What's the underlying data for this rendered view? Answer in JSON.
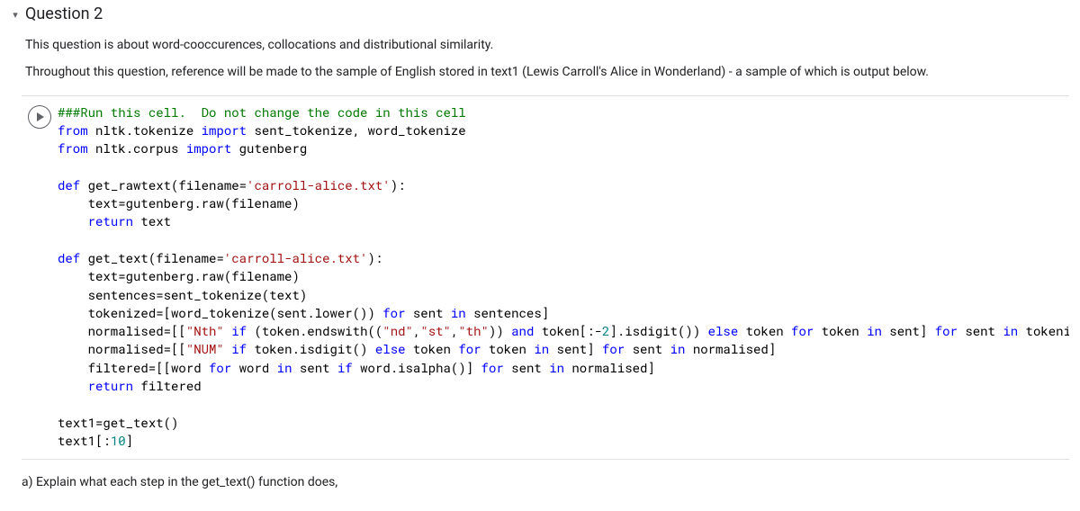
{
  "header": {
    "toggle_glyph": "▾",
    "title": "Question 2"
  },
  "intro": {
    "p1": "This question is about word-cooccurences, collocations and distributional similarity.",
    "p2": "Throughout this question, reference will be made to the sample of English stored in text1 (Lewis Carroll's Alice in Wonderland) - a sample of which is output below."
  },
  "code": {
    "l1_a": "###Run this cell.",
    "l1_b": "  Do not change the code in this cell",
    "l2_a": "from",
    "l2_b": " nltk.tokenize ",
    "l2_c": "import",
    "l2_d": " sent_tokenize, word_tokenize",
    "l3_a": "from",
    "l3_b": " nltk.corpus ",
    "l3_c": "import",
    "l3_d": " gutenberg",
    "l5_a": "def",
    "l5_b": " get_rawtext(filename=",
    "l5_c": "'carroll-alice.txt'",
    "l5_d": "):",
    "l6": "    text=gutenberg.raw(filename)",
    "l7_a": "    ",
    "l7_b": "return",
    "l7_c": " text",
    "l9_a": "def",
    "l9_b": " get_text(filename=",
    "l9_c": "'carroll-alice.txt'",
    "l9_d": "):",
    "l10": "    text=gutenberg.raw(filename)",
    "l11": "    sentences=sent_tokenize(text)",
    "l12_a": "    tokenized=[word_tokenize(sent.lower()) ",
    "l12_b": "for",
    "l12_c": " sent ",
    "l12_d": "in",
    "l12_e": " sentences]",
    "l13_a": "    normalised=[[",
    "l13_b": "\"Nth\"",
    "l13_c": " ",
    "l13_d": "if",
    "l13_e": " (token.endswith((",
    "l13_f": "\"nd\"",
    "l13_g": ",",
    "l13_h": "\"st\"",
    "l13_i": ",",
    "l13_j": "\"th\"",
    "l13_k": ")) ",
    "l13_l": "and",
    "l13_m": " token[:-",
    "l13_n": "2",
    "l13_o": "].isdigit()) ",
    "l13_p": "else",
    "l13_q": " token ",
    "l13_r": "for",
    "l13_s": " token ",
    "l13_t": "in",
    "l13_u": " sent] ",
    "l13_v": "for",
    "l13_w": " sent ",
    "l13_x": "in",
    "l13_y": " tokenized]",
    "l14_a": "    normalised=[[",
    "l14_b": "\"NUM\"",
    "l14_c": " ",
    "l14_d": "if",
    "l14_e": " token.isdigit() ",
    "l14_f": "else",
    "l14_g": " token ",
    "l14_h": "for",
    "l14_i": " token ",
    "l14_j": "in",
    "l14_k": " sent] ",
    "l14_l": "for",
    "l14_m": " sent ",
    "l14_n": "in",
    "l14_o": " normalised]",
    "l15_a": "    filtered=[[word ",
    "l15_b": "for",
    "l15_c": " word ",
    "l15_d": "in",
    "l15_e": " sent ",
    "l15_f": "if",
    "l15_g": " word.isalpha()] ",
    "l15_h": "for",
    "l15_i": " sent ",
    "l15_j": "in",
    "l15_k": " normalised]",
    "l16_a": "    ",
    "l16_b": "return",
    "l16_c": " filtered",
    "l18": "text1=get_text()",
    "l19_a": "text1[:",
    "l19_b": "10",
    "l19_c": "]"
  },
  "sub": {
    "a": "a) Explain what each step in the get_text() function does,"
  }
}
